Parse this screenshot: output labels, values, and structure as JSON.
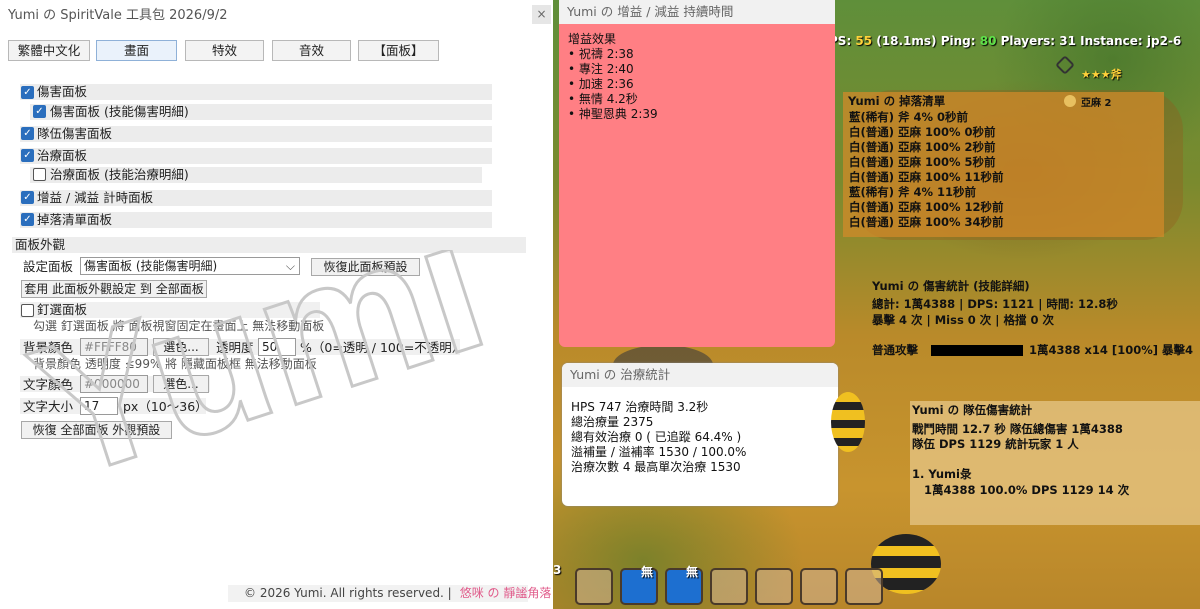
{
  "window": {
    "title": "Yumi の SpiritVale 工具包 2026/9/2",
    "close": "×"
  },
  "tabs": [
    "繁體中文化",
    "畫面",
    "特效",
    "音效",
    "【面板】"
  ],
  "panels_section": {
    "items": [
      {
        "label": "傷害面板",
        "checked": true
      },
      {
        "label": "傷害面板 (技能傷害明細)",
        "checked": true
      },
      {
        "label": "隊伍傷害面板",
        "checked": true
      },
      {
        "label": "治療面板",
        "checked": true
      },
      {
        "label": "治療面板 (技能治療明細)",
        "checked": false
      },
      {
        "label": "增益 / 減益 計時面板",
        "checked": true
      },
      {
        "label": "掉落清單面板",
        "checked": true
      }
    ]
  },
  "appearance": {
    "heading": "面板外觀",
    "set_panel_label": "設定面板",
    "set_panel_value": "傷害面板 (技能傷害明細)",
    "restore_panel_button": "恢復此面板預設",
    "apply_all_button": "套用 此面板外觀設定 到 全部面板",
    "pin_label": "釘選面板",
    "pin_hint": "勾選 釘選面板 將 面板視窗固定在畫面上 無法移動面板",
    "bg_color_label": "背景顏色",
    "bg_color_value": "#FFFF80",
    "pick_button": "選色...",
    "opacity_label": "透明度",
    "opacity_value": "50",
    "opacity_unit": "%（0=透明 / 100=不透明）",
    "bg_hint": "背景顏色 透明度 ≤99% 將 隱藏面板框 無法移動面板",
    "text_color_label": "文字顏色",
    "text_color_value": "#000000",
    "font_size_label": "文字大小",
    "font_size_value": "17",
    "font_size_unit": "px（10～36）",
    "restore_all_button": "恢復 全部面板 外觀預設"
  },
  "footer": {
    "copyright": "© 2026 Yumi. All rights reserved. |",
    "brand": "悠咪 の 靜謐角落"
  },
  "watermark": {
    "text": "Yumi"
  },
  "hud": {
    "fps_prefix": "PS: ",
    "fps_value": "55",
    "fps_ms": " (18.1ms) ",
    "ping_prefix": "Ping: ",
    "ping_value": "80",
    "players": " Players: 31 ",
    "instance": "Instance: jp2-6",
    "stars": "★★★斧"
  },
  "buff_panel": {
    "header": "Yumi の 增益 / 減益 持續時間",
    "title": "增益效果",
    "items": [
      "• 祝禱 2:38",
      "• 專注 2:40",
      "• 加速 2:36",
      "• 無情 4.2秒",
      "• 神聖恩典 2:39"
    ]
  },
  "loot_panel": {
    "header": "Yumi の 掉落清單",
    "top_item": "亞麻 2",
    "rows": [
      "藍(稀有)  斧  4%  0秒前",
      "白(普通)  亞麻  100%  0秒前",
      "白(普通)  亞麻  100%  2秒前",
      "白(普通)  亞麻  100%  5秒前",
      "白(普通)  亞麻  100%  11秒前",
      "藍(稀有)  斧  4%  11秒前",
      "白(普通)  亞麻  100%  12秒前",
      "白(普通)  亞麻  100%  34秒前"
    ]
  },
  "damage_panel": {
    "header": "Yumi の 傷害統計 (技能詳細)",
    "line1": "總計: 1萬4388 | DPS: 1121 | 時間: 12.8秒",
    "line2": "暴擊 4 次 | Miss 0 次 | 格擋 0 次",
    "skill_name": "普通攻擊",
    "skill_stats": "1萬4388 x14 [100%] 暴擊4",
    "bar_fraction": 1.0
  },
  "heal_panel": {
    "header": "Yumi の 治療統計",
    "lines": [
      "HPS  747   治療時間 3.2秒",
      "總治療量 2375",
      "總有效治療  0 ( 已追蹤 64.4% )",
      "溢補量 / 溢補率  1530 / 100.0%",
      "治療次數  4    最高單次治療 1530"
    ]
  },
  "party_panel": {
    "header": "Yumi の 隊伍傷害統計",
    "line1": "戰鬥時間 12.7 秒   隊伍總傷害 1萬4388",
    "line2": "隊伍 DPS 1129   統計玩家 1 人",
    "member": "1. Yumi彔",
    "member_stats": "1萬4388 100.0%   DPS 1129   14 次"
  },
  "hotbar": {
    "label_left": "3",
    "slot_labels": [
      "無",
      "無"
    ]
  },
  "colors": {
    "accent": "#2a6ebd",
    "buff_bg": "#ff7f84",
    "loot_bg": "#d08a2a",
    "party_bg": "#e6c587",
    "hud_green": "#5fe04a",
    "hud_yellow": "#ffd23a"
  },
  "icons": [
    "close-icon",
    "checkbox-icon",
    "chevron-down-icon",
    "frost-skill-icon",
    "flax-icon",
    "axe-icon"
  ]
}
